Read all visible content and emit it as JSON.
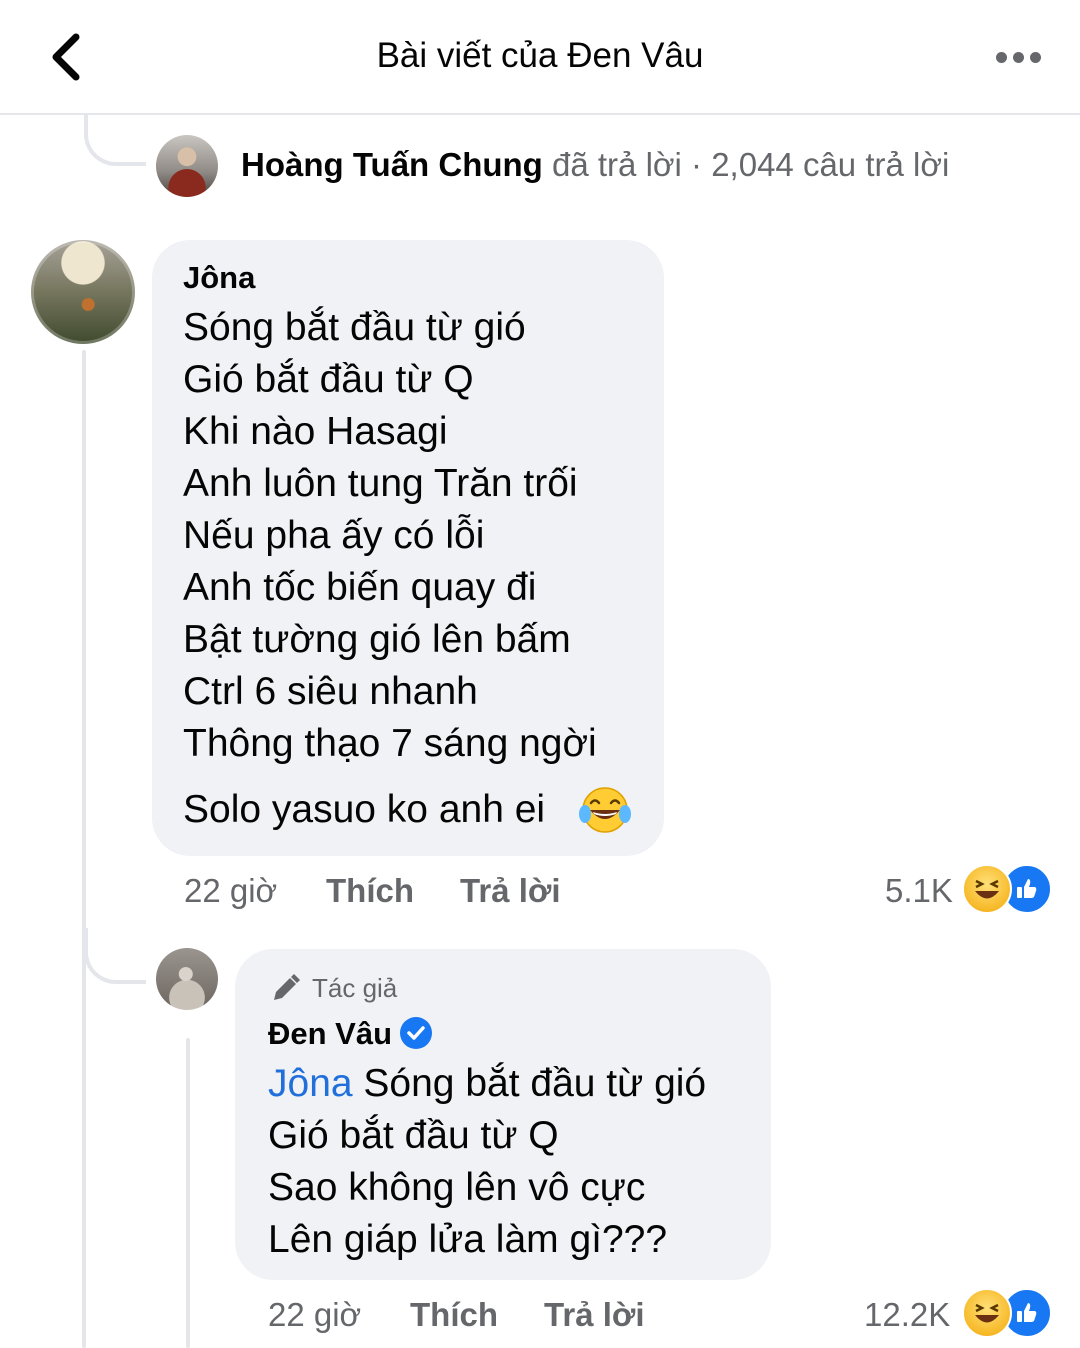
{
  "header": {
    "title": "Bài viết của Đen Vâu",
    "back_icon": "chevron-left-icon",
    "more_icon": "more-horizontal-icon"
  },
  "reply_summary": {
    "name": "Hoàng Tuấn Chung",
    "action": " đã trả lời",
    "count": " · 2,044 câu trả lời"
  },
  "comment1": {
    "author": "Jôna",
    "lines": [
      "Sóng bắt đầu từ gió",
      "Gió bắt đầu từ Q",
      "Khi nào Hasagi",
      "Anh luôn tung Trăn trối",
      "Nếu pha ấy có lỗi",
      "Anh tốc biến quay đi",
      "Bật tường gió lên bấm",
      "Ctrl 6 siêu nhanh",
      "Thông thạo 7 sáng ngời",
      "Solo yasuo ko anh ei"
    ],
    "emoji": "laughing-tears-emoji",
    "time": "22 giờ",
    "like_label": "Thích",
    "reply_label": "Trả lời",
    "reaction_count": "5.1K",
    "reaction_icons": [
      "haha-reaction-icon",
      "like-reaction-icon"
    ]
  },
  "comment2": {
    "badge_icon": "pencil-icon",
    "badge": "Tác giả",
    "author": "Đen Vâu",
    "verified_icon": "verified-badge-icon",
    "mention": "Jôna",
    "lines": [
      " Sóng bắt đầu từ gió",
      "Gió bắt đầu từ Q",
      "Sao không lên vô cực",
      "Lên giáp lửa làm gì???"
    ],
    "time": "22 giờ",
    "like_label": "Thích",
    "reply_label": "Trả lời",
    "reaction_count": "12.2K",
    "reaction_icons": [
      "haha-reaction-icon",
      "like-reaction-icon"
    ]
  },
  "colors": {
    "bubble": "#f0f2f5",
    "secondary_text": "#65676b",
    "mention": "#216fdb",
    "like_blue": "#1877f2",
    "haha_yellow": "#f7b928"
  }
}
